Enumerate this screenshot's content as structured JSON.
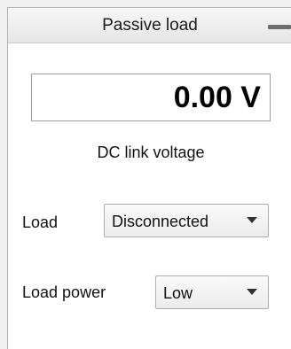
{
  "panel": {
    "title": "Passive load",
    "minimize_icon": "minimize-icon"
  },
  "dc_link": {
    "value": "0.00 V",
    "caption": "DC link voltage"
  },
  "load": {
    "label": "Load",
    "selected": "Disconnected"
  },
  "load_power": {
    "label": "Load power",
    "selected": "Low"
  },
  "icons": {
    "dropdown": "chevron-down-icon"
  }
}
